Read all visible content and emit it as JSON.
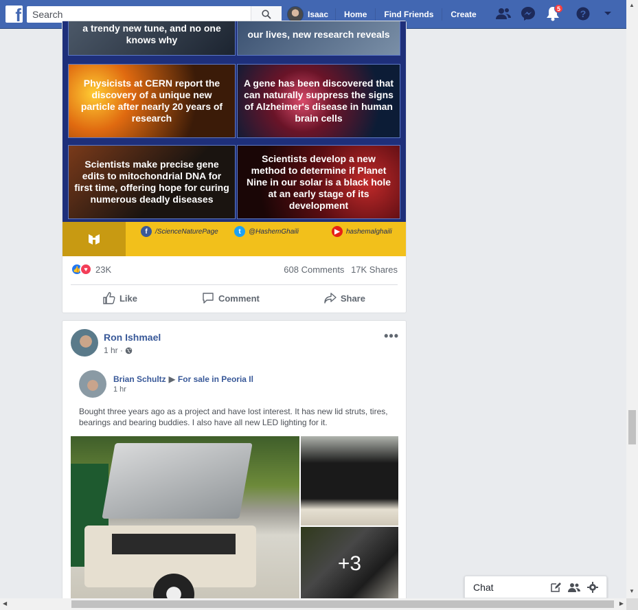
{
  "header": {
    "search_placeholder": "Search",
    "user_name": "Isaac",
    "nav": [
      "Home",
      "Find Friends",
      "Create"
    ],
    "notifications_count": "5"
  },
  "post1": {
    "tiles": [
      "a trendy new tune, and no one knows why",
      "our lives, new research reveals",
      "Physicists at CERN report the discovery of a unique new particle after nearly 20 years of research",
      "A gene has been discovered that can naturally suppress the signs of Alzheimer's disease in human brain cells",
      "Scientists make precise gene edits to mitochondrial DNA for first time, offering hope for curing numerous deadly diseases",
      "Scientists develop a new method to determine if Planet Nine in our solar is a black hole at an early stage of its development"
    ],
    "social": [
      "/ScienceNaturePage",
      "@HashemGhaili",
      "hashemalghaili"
    ],
    "reaction_count": "23K",
    "comments": "608 Comments",
    "shares": "17K Shares",
    "actions": [
      "Like",
      "Comment",
      "Share"
    ]
  },
  "post2": {
    "author": "Ron Ishmael",
    "time": "1 hr ·",
    "shared_author": "Brian Schultz",
    "shared_group": "For sale in Peoria Il",
    "shared_time": "1 hr",
    "text": "Bought three years ago as a project and have lost interest. It has new lid struts, tires, bearings and bearing buddies. I also have all new LED lighting for it.",
    "more_photos": "+3"
  },
  "chat": {
    "label": "Chat"
  },
  "colors": {
    "brand": "#4267b2",
    "link": "#385898",
    "badge": "#fa3e3e"
  }
}
